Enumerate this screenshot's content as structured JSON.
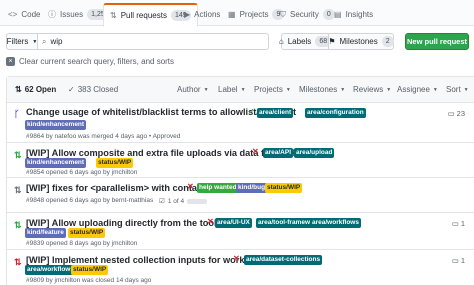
{
  "colors": {
    "open": "#28a745",
    "merged": "#6f42c1",
    "draft": "#6a737d",
    "closed": "#cb2431",
    "accent": "#e36209",
    "primary": "#2ea44f"
  },
  "tabs": [
    {
      "label": "Code",
      "icon": "code-icon",
      "glyph": "<>"
    },
    {
      "label": "Issues",
      "icon": "issue-icon",
      "glyph": "ⓘ",
      "count": "1,258"
    },
    {
      "label": "Pull requests",
      "icon": "pull-request-icon",
      "glyph": "⇅",
      "count": "149"
    },
    {
      "label": "Actions",
      "icon": "play-icon",
      "glyph": "▶"
    },
    {
      "label": "Projects",
      "icon": "project-icon",
      "glyph": "▦",
      "count": "9"
    },
    {
      "label": "Security",
      "icon": "shield-icon",
      "glyph": "⛉",
      "count": "0"
    },
    {
      "label": "Insights",
      "icon": "graph-icon",
      "glyph": "▤"
    }
  ],
  "filter": {
    "filters_label": "Filters",
    "search_value": "wip",
    "labels_label": "Labels",
    "labels_count": "68",
    "milestones_label": "Milestones",
    "milestones_count": "2",
    "new_pr_label": "New pull request",
    "clear_label": "Clear current search query, filters, and sorts"
  },
  "list_header": {
    "open_label": "62 Open",
    "closed_label": "383 Closed",
    "columns": [
      "Author",
      "Label",
      "Projects",
      "Milestones",
      "Reviews",
      "Assignee",
      "Sort"
    ]
  },
  "prs": [
    {
      "title": "Change usage of whitelist/blacklist terms to allowlist/blocklist",
      "state": "merged",
      "ci": "pass",
      "meta": "#9864 by natefoo was merged 4 days ago • Approved",
      "comments": "23",
      "labels": [
        {
          "text": "area/client",
          "bg": "#006b75",
          "fg": "#ffffff"
        },
        {
          "text": "area/configuration",
          "bg": "#006b75",
          "fg": "#ffffff"
        },
        {
          "text": "kind/enhancement",
          "bg": "#5f6db6",
          "fg": "#ffffff"
        }
      ]
    },
    {
      "title": "[WIP] Allow composite and extra file uploads via data fetch API",
      "state": "open",
      "ci": "fail",
      "meta": "#9854 opened 6 days ago by jmchilton",
      "labels": [
        {
          "text": "area/API",
          "bg": "#006b75",
          "fg": "#ffffff"
        },
        {
          "text": "area/upload",
          "bg": "#006b75",
          "fg": "#ffffff"
        },
        {
          "text": "kind/enhancement",
          "bg": "#5f6db6",
          "fg": "#ffffff"
        },
        {
          "text": "status/WIP",
          "bg": "#fbca04",
          "fg": "#24292e"
        }
      ]
    },
    {
      "title": "[WIP] fixes for <parallelism> with containers",
      "state": "open",
      "ci": "fail",
      "meta": "#9848 opened 6 days ago by bernt-matthias",
      "progress": "1 of 4",
      "labels": [
        {
          "text": "help wanted",
          "bg": "#33aa3f",
          "fg": "#ffffff"
        },
        {
          "text": "kind/bug",
          "bg": "#5f6db6",
          "fg": "#ffffff"
        },
        {
          "text": "status/WIP",
          "bg": "#fbca04",
          "fg": "#24292e"
        }
      ]
    },
    {
      "title": "[WIP] Allow uploading directly from the tool form",
      "state": "open",
      "ci": "fail",
      "meta": "#9839 opened 8 days ago by jmchilton",
      "comments": "1",
      "labels": [
        {
          "text": "area/UI-UX",
          "bg": "#006b75",
          "fg": "#ffffff"
        },
        {
          "text": "area/tool-framework",
          "bg": "#006b75",
          "fg": "#ffffff"
        },
        {
          "text": "area/workflows",
          "bg": "#006b75",
          "fg": "#ffffff"
        },
        {
          "text": "kind/feature",
          "bg": "#5f6db6",
          "fg": "#ffffff"
        },
        {
          "text": "status/WIP",
          "bg": "#fbca04",
          "fg": "#24292e"
        }
      ]
    },
    {
      "title": "[WIP] Implement nested collection inputs for workflow tests",
      "state": "closed",
      "ci": "fail",
      "meta": "#9809 by jmchilton was closed 14 days ago",
      "comments": "1",
      "labels": [
        {
          "text": "area/dataset-collections",
          "bg": "#006b75",
          "fg": "#ffffff"
        },
        {
          "text": "area/workflows",
          "bg": "#006b75",
          "fg": "#ffffff"
        },
        {
          "text": "status/WIP",
          "bg": "#fbca04",
          "fg": "#24292e"
        }
      ]
    }
  ]
}
